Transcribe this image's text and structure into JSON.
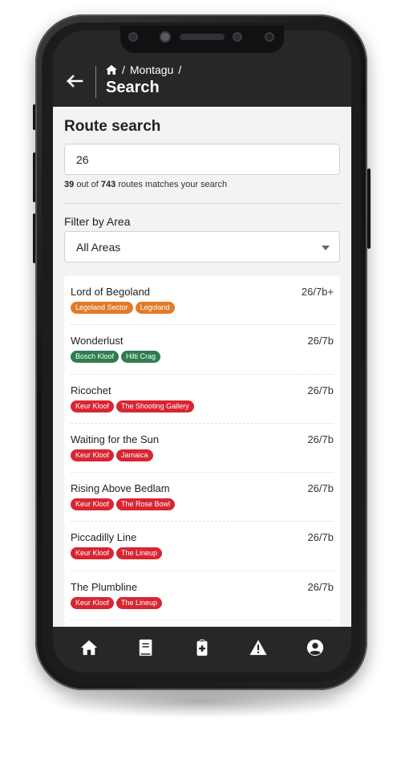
{
  "header": {
    "back_icon": "arrow-left-icon",
    "breadcrumb_home_icon": "home-icon",
    "breadcrumb_sep": "/",
    "breadcrumb_item": "Montagu",
    "title": "Search"
  },
  "search": {
    "heading": "Route search",
    "query": "26",
    "matches": "39",
    "matches_mid": "out of",
    "total": "743",
    "matches_suffix": "routes matches your search"
  },
  "filter": {
    "label": "Filter by Area",
    "selected": "All Areas"
  },
  "colors": {
    "orange": "#e07b2a",
    "green": "#2e7d4f",
    "red": "#d72631",
    "dark": "#262728"
  },
  "routes": [
    {
      "name": "Lord of Begoland",
      "grade": "26/7b+",
      "tags": [
        {
          "label": "Legoland Sector",
          "color": "#e07b2a"
        },
        {
          "label": "Legoland",
          "color": "#e07b2a"
        }
      ]
    },
    {
      "name": "Wonderlust",
      "grade": "26/7b",
      "tags": [
        {
          "label": "Bosch Kloof",
          "color": "#2e7d4f"
        },
        {
          "label": "Hilti Crag",
          "color": "#2e7d4f"
        }
      ]
    },
    {
      "name": "Ricochet",
      "grade": "26/7b",
      "tags": [
        {
          "label": "Keur Kloof",
          "color": "#d72631"
        },
        {
          "label": "The Shooting Gallery",
          "color": "#d72631"
        }
      ]
    },
    {
      "name": "Waiting for the Sun",
      "grade": "26/7b",
      "tags": [
        {
          "label": "Keur Kloof",
          "color": "#d72631"
        },
        {
          "label": "Jamaica",
          "color": "#d72631"
        }
      ]
    },
    {
      "name": "Rising Above Bedlam",
      "grade": "26/7b",
      "tags": [
        {
          "label": "Keur Kloof",
          "color": "#d72631"
        },
        {
          "label": "The Rose Bowl",
          "color": "#d72631"
        }
      ]
    },
    {
      "name": "Piccadilly Line",
      "grade": "26/7b",
      "tags": [
        {
          "label": "Keur Kloof",
          "color": "#d72631"
        },
        {
          "label": "The Lineup",
          "color": "#d72631"
        }
      ]
    },
    {
      "name": "The Plumbline",
      "grade": "26/7b",
      "tags": [
        {
          "label": "Keur Kloof",
          "color": "#d72631"
        },
        {
          "label": "The Lineup",
          "color": "#d72631"
        }
      ]
    }
  ],
  "nav": [
    {
      "icon": "home-icon"
    },
    {
      "icon": "book-icon"
    },
    {
      "icon": "clipboard-medical-icon"
    },
    {
      "icon": "warning-icon"
    },
    {
      "icon": "user-circle-icon"
    }
  ]
}
